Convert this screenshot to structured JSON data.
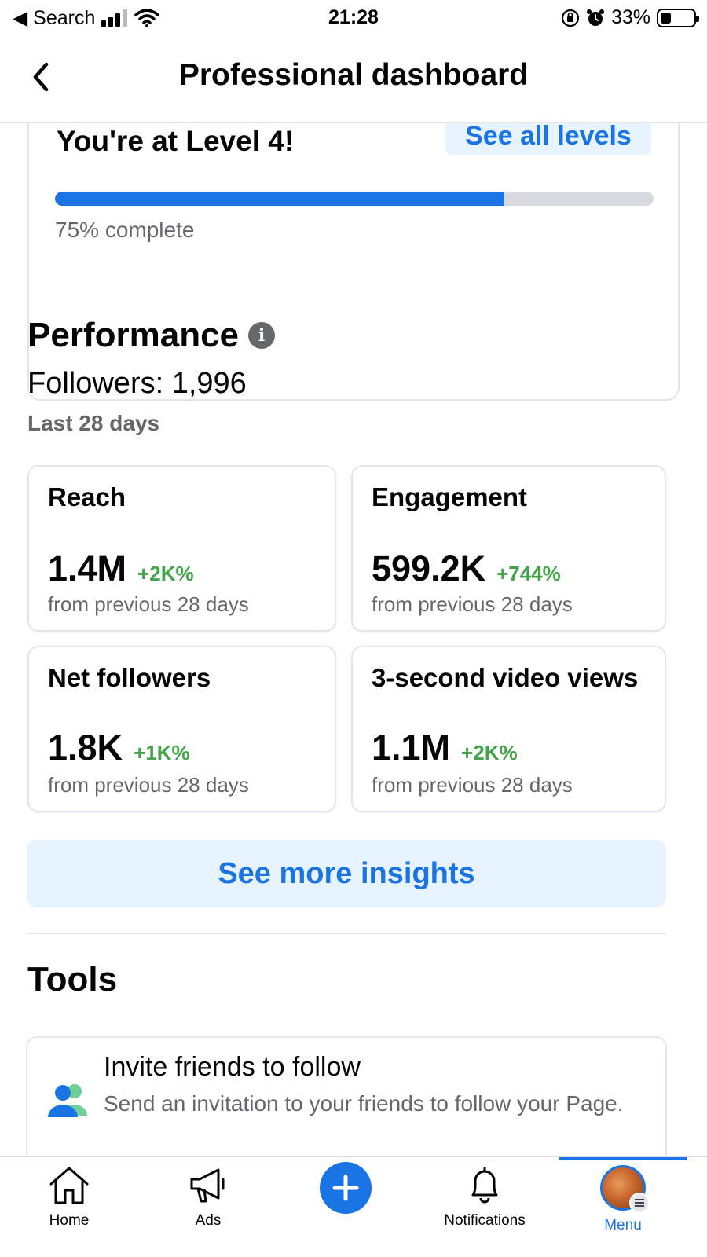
{
  "status_bar": {
    "back_app": "◀ Search",
    "time": "21:28",
    "battery": "33%",
    "battery_level": 0.33
  },
  "header": {
    "title": "Professional dashboard"
  },
  "level": {
    "title": "You're at Level 4!",
    "see_all_label": "See all levels",
    "progress_percent": 75,
    "progress_text": "75% complete"
  },
  "performance": {
    "title": "Performance",
    "followers_text": "Followers: 1,996",
    "period": "Last 28 days",
    "metrics": [
      {
        "name": "Reach",
        "value": "1.4M",
        "change": "+2K%",
        "sub": "from previous 28 days"
      },
      {
        "name": "Engagement",
        "value": "599.2K",
        "change": "+744%",
        "sub": "from previous 28 days"
      },
      {
        "name": "Net followers",
        "value": "1.8K",
        "change": "+1K%",
        "sub": "from previous 28 days"
      },
      {
        "name": "3-second video views",
        "value": "1.1M",
        "change": "+2K%",
        "sub": "from previous 28 days"
      }
    ],
    "insights_label": "See more insights"
  },
  "tools": {
    "title": "Tools",
    "items": [
      {
        "title": "Invite friends to follow",
        "desc": "Send an invitation to your friends to follow your Page.",
        "icon": "people-icon"
      }
    ]
  },
  "bottom_nav": {
    "items": [
      {
        "label": "Home",
        "icon": "home-icon"
      },
      {
        "label": "Ads",
        "icon": "megaphone-icon"
      },
      {
        "label": "",
        "icon": "plus-icon"
      },
      {
        "label": "Notifications",
        "icon": "bell-icon"
      },
      {
        "label": "Menu",
        "icon": "avatar"
      }
    ],
    "active": "Menu"
  },
  "colors": {
    "accent": "#1b74e4",
    "positive": "#42a348",
    "secondary_text": "#65676b",
    "light_accent_bg": "#e7f3ff"
  }
}
